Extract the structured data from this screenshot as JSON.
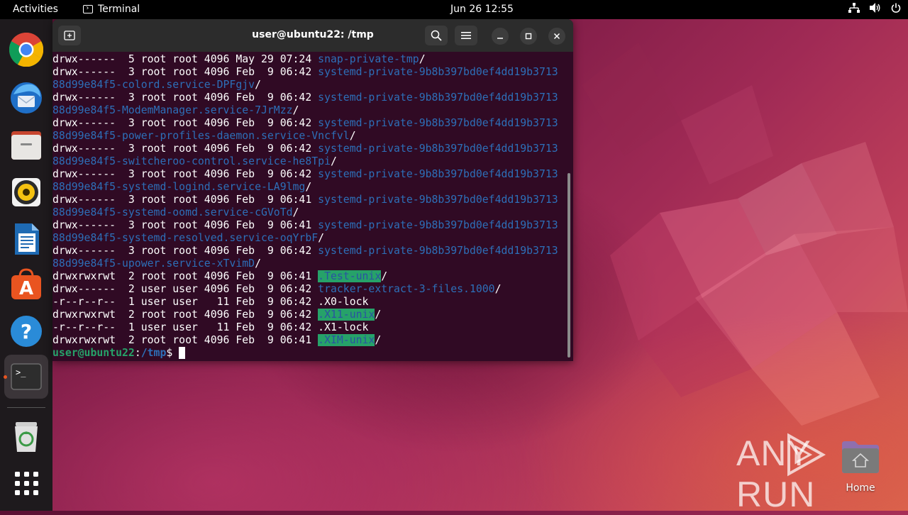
{
  "topbar": {
    "activities": "Activities",
    "app_name": "Terminal",
    "clock": "Jun 26  12:55",
    "tray_icons": [
      "network-icon",
      "volume-icon",
      "power-icon"
    ]
  },
  "dock": {
    "items": [
      {
        "name": "Google Chrome",
        "icon": "chrome-icon"
      },
      {
        "name": "Thunderbird",
        "icon": "thunderbird-icon"
      },
      {
        "name": "Files",
        "icon": "files-icon"
      },
      {
        "name": "Rhythmbox",
        "icon": "rhythmbox-icon"
      },
      {
        "name": "LibreOffice Writer",
        "icon": "writer-icon"
      },
      {
        "name": "Ubuntu Software",
        "icon": "software-icon"
      },
      {
        "name": "Help",
        "icon": "help-icon"
      },
      {
        "name": "Terminal",
        "icon": "terminal-icon"
      },
      {
        "name": "Trash",
        "icon": "trash-icon"
      },
      {
        "name": "Show Applications",
        "icon": "app-grid-icon"
      }
    ]
  },
  "terminal": {
    "title": "user@ubuntu22: /tmp",
    "lines": [
      [
        {
          "t": "drwx------  5 root root 4096 May 29 07:24 "
        },
        {
          "t": "snap-private-tmp",
          "c": "dir"
        },
        {
          "t": "/"
        }
      ],
      [
        {
          "t": "drwx------  3 root root 4096 Feb  9 06:42 "
        },
        {
          "t": "systemd-private-9b8b397bd0ef4dd19b3713",
          "c": "dir"
        }
      ],
      [
        {
          "t": "88d99e84f5-colord.service-DPFgjv",
          "c": "dir"
        },
        {
          "t": "/"
        }
      ],
      [
        {
          "t": "drwx------  3 root root 4096 Feb  9 06:42 "
        },
        {
          "t": "systemd-private-9b8b397bd0ef4dd19b3713",
          "c": "dir"
        }
      ],
      [
        {
          "t": "88d99e84f5-ModemManager.service-7JrMzz",
          "c": "dir"
        },
        {
          "t": "/"
        }
      ],
      [
        {
          "t": "drwx------  3 root root 4096 Feb  9 06:42 "
        },
        {
          "t": "systemd-private-9b8b397bd0ef4dd19b3713",
          "c": "dir"
        }
      ],
      [
        {
          "t": "88d99e84f5-power-profiles-daemon.service-Vncfvl",
          "c": "dir"
        },
        {
          "t": "/"
        }
      ],
      [
        {
          "t": "drwx------  3 root root 4096 Feb  9 06:42 "
        },
        {
          "t": "systemd-private-9b8b397bd0ef4dd19b3713",
          "c": "dir"
        }
      ],
      [
        {
          "t": "88d99e84f5-switcheroo-control.service-he8Tpi",
          "c": "dir"
        },
        {
          "t": "/"
        }
      ],
      [
        {
          "t": "drwx------  3 root root 4096 Feb  9 06:42 "
        },
        {
          "t": "systemd-private-9b8b397bd0ef4dd19b3713",
          "c": "dir"
        }
      ],
      [
        {
          "t": "88d99e84f5-systemd-logind.service-LA9lmg",
          "c": "dir"
        },
        {
          "t": "/"
        }
      ],
      [
        {
          "t": "drwx------  3 root root 4096 Feb  9 06:41 "
        },
        {
          "t": "systemd-private-9b8b397bd0ef4dd19b3713",
          "c": "dir"
        }
      ],
      [
        {
          "t": "88d99e84f5-systemd-oomd.service-cGVoTd",
          "c": "dir"
        },
        {
          "t": "/"
        }
      ],
      [
        {
          "t": "drwx------  3 root root 4096 Feb  9 06:41 "
        },
        {
          "t": "systemd-private-9b8b397bd0ef4dd19b3713",
          "c": "dir"
        }
      ],
      [
        {
          "t": "88d99e84f5-systemd-resolved.service-oqYrbF",
          "c": "dir"
        },
        {
          "t": "/"
        }
      ],
      [
        {
          "t": "drwx------  3 root root 4096 Feb  9 06:42 "
        },
        {
          "t": "systemd-private-9b8b397bd0ef4dd19b3713",
          "c": "dir"
        }
      ],
      [
        {
          "t": "88d99e84f5-upower.service-xTvimD",
          "c": "dir"
        },
        {
          "t": "/"
        }
      ],
      [
        {
          "t": "drwxrwxrwt  2 root root 4096 Feb  9 06:41 "
        },
        {
          "t": ".Test-unix",
          "c": "hl"
        },
        {
          "t": "/"
        }
      ],
      [
        {
          "t": "drwx------  2 user user 4096 Feb  9 06:42 "
        },
        {
          "t": "tracker-extract-3-files.1000",
          "c": "dir"
        },
        {
          "t": "/"
        }
      ],
      [
        {
          "t": "-r--r--r--  1 user user   11 Feb  9 06:42 .X0-lock"
        }
      ],
      [
        {
          "t": "drwxrwxrwt  2 root root 4096 Feb  9 06:42 "
        },
        {
          "t": ".X11-unix",
          "c": "hl"
        },
        {
          "t": "/"
        }
      ],
      [
        {
          "t": "-r--r--r--  1 user user   11 Feb  9 06:42 .X1-lock"
        }
      ],
      [
        {
          "t": "drwxrwxrwt  2 root root 4096 Feb  9 06:41 "
        },
        {
          "t": ".XIM-unix",
          "c": "hl"
        },
        {
          "t": "/"
        }
      ]
    ],
    "prompt": {
      "user": "user@ubuntu22",
      "sep": ":",
      "path": "/tmp",
      "symbol": "$ "
    }
  },
  "desktop": {
    "home_label": "Home",
    "watermark": "ANY RUN"
  },
  "colors": {
    "terminal_bg": "#300a24",
    "dir_blue": "#2d6fb8",
    "highlight_green": "#26a269",
    "accent_orange": "#e95420"
  }
}
